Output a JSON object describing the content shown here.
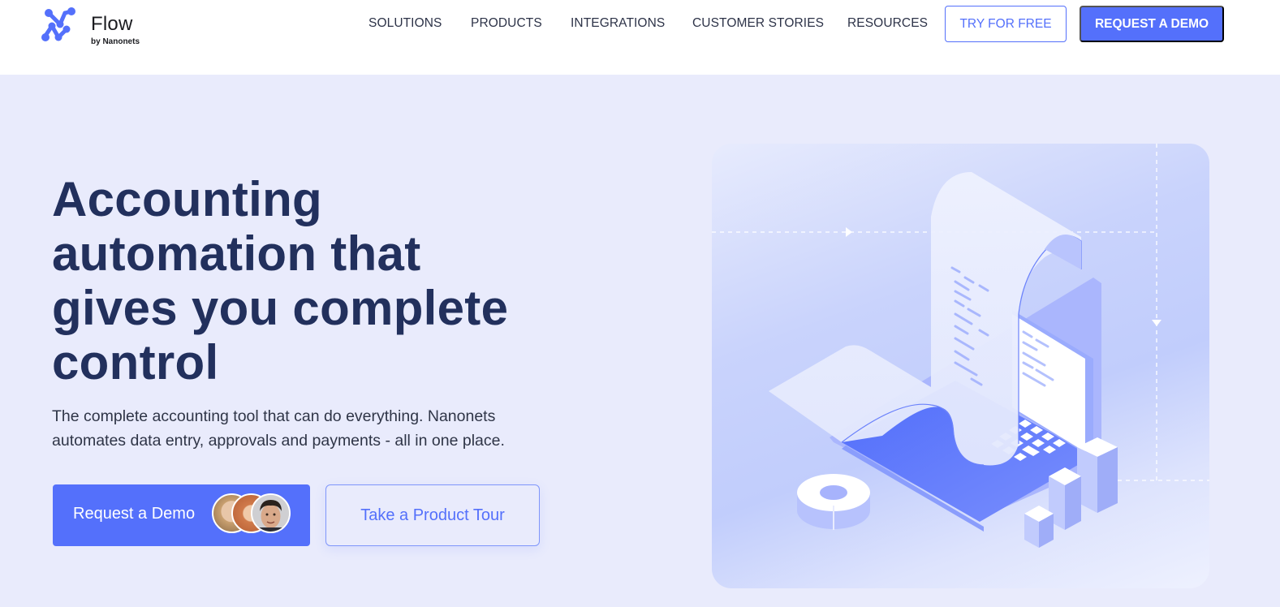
{
  "brand": {
    "name": "Flow",
    "tagline": "by Nanonets",
    "logo_icon": "nanonets-n-logo-icon",
    "accent_color": "#5470fb",
    "heading_color": "#22305d"
  },
  "nav": {
    "items": [
      {
        "label": "SOLUTIONS"
      },
      {
        "label": "PRODUCTS"
      },
      {
        "label": "INTEGRATIONS"
      },
      {
        "label": "CUSTOMER STORIES"
      },
      {
        "label": "RESOURCES"
      }
    ],
    "try_free_label": "TRY FOR FREE",
    "request_demo_label": "REQUEST A DEMO"
  },
  "hero": {
    "title_lines": [
      "Accounting",
      "automation that",
      "gives you complete",
      "control"
    ],
    "subtitle_lines": [
      "The complete accounting tool that can do everything. Nanonets",
      "automates data entry, approvals and payments - all in one place."
    ],
    "primary_cta": "Request a Demo",
    "secondary_cta": "Take a Product Tour",
    "avatars": [
      "woman-blonde-avatar",
      "woman-redhead-avatar",
      "man-dark-hair-avatar"
    ]
  },
  "illustration": {
    "subject": "isometric laptop with scrolling receipt, donut chart and bar chart",
    "icons": [
      "laptop-icon",
      "receipt-scroll-icon",
      "donut-chart-icon",
      "bar-chart-icon"
    ]
  }
}
